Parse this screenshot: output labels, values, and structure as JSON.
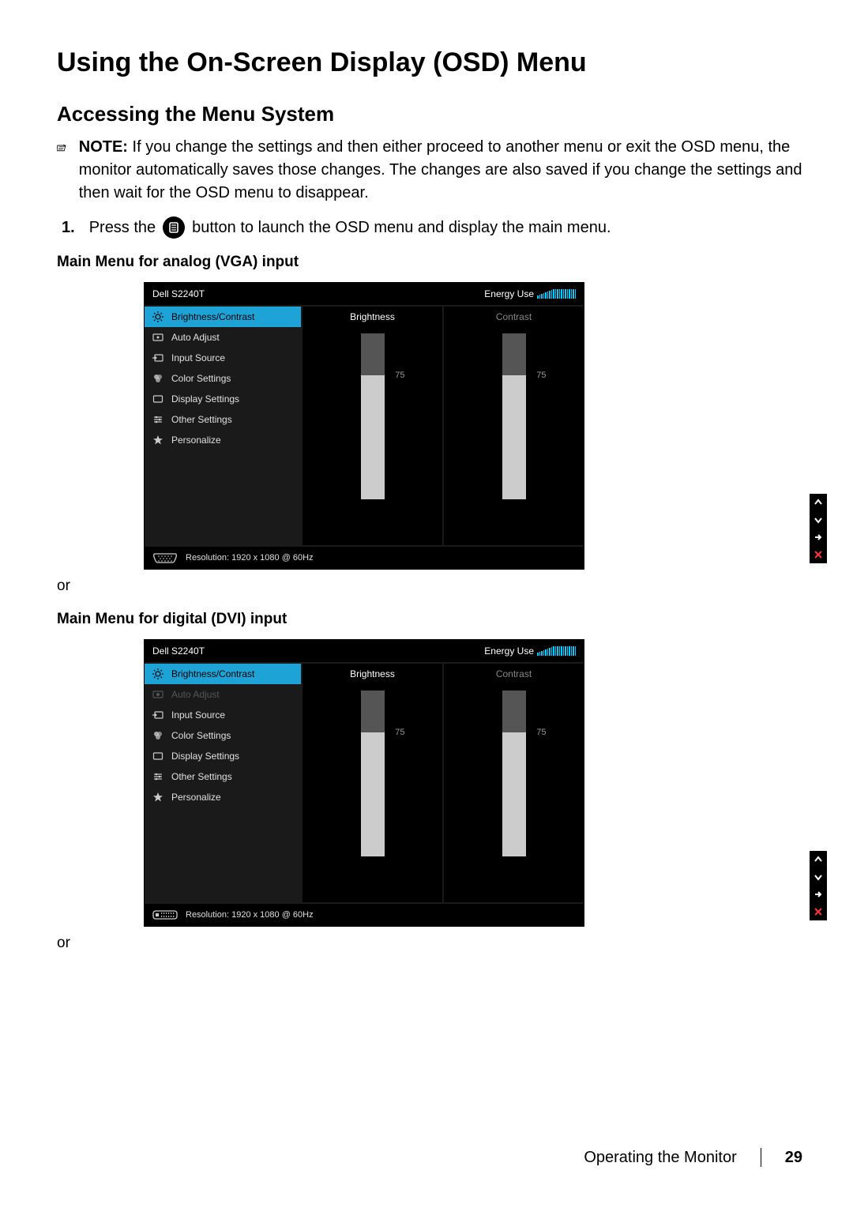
{
  "heading": "Using the On-Screen Display (OSD) Menu",
  "subheading": "Accessing the Menu System",
  "note": {
    "prefix": "NOTE:",
    "body": " If you change the settings and then either proceed to another menu or exit the OSD menu, the monitor automatically saves those changes. The changes are also saved if you change the settings and then wait for the OSD menu to disappear."
  },
  "step1": {
    "num": "1.",
    "before": "Press the ",
    "after": " button to launch the OSD menu and display the main menu."
  },
  "vga_heading": "Main Menu for analog (VGA) input",
  "dvi_heading": "Main Menu for digital (DVI) input",
  "or_label": "or",
  "osd": {
    "model": "Dell S2240T",
    "energy_label": "Energy Use",
    "menu": [
      {
        "label": "Brightness/Contrast",
        "icon": "sun"
      },
      {
        "label": "Auto Adjust",
        "icon": "auto"
      },
      {
        "label": "Input Source",
        "icon": "input"
      },
      {
        "label": "Color Settings",
        "icon": "color"
      },
      {
        "label": "Display Settings",
        "icon": "display"
      },
      {
        "label": "Other Settings",
        "icon": "other"
      },
      {
        "label": "Personalize",
        "icon": "star"
      }
    ],
    "brightness_label": "Brightness",
    "contrast_label": "Contrast",
    "brightness_value": "75",
    "contrast_value": "75",
    "resolution": "Resolution: 1920 x 1080 @ 60Hz"
  },
  "nav_icons": {
    "up": "up",
    "down": "down",
    "enter": "enter",
    "close": "close"
  },
  "footer": {
    "section": "Operating the Monitor",
    "page": "29"
  }
}
